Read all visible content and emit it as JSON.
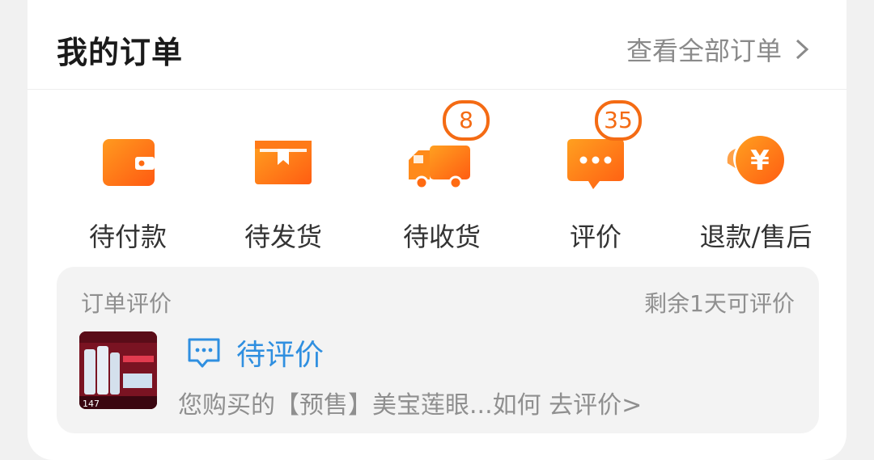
{
  "header": {
    "title": "我的订单",
    "view_all": "查看全部订单"
  },
  "order_status": [
    {
      "label": "待付款",
      "icon": "wallet-icon",
      "badge": null
    },
    {
      "label": "待发货",
      "icon": "package-box-icon",
      "badge": null
    },
    {
      "label": "待收货",
      "icon": "delivery-truck-icon",
      "badge": "8"
    },
    {
      "label": "评价",
      "icon": "chat-bubble-icon",
      "badge": "35"
    },
    {
      "label": "退款/售后",
      "icon": "refund-yen-icon",
      "badge": null
    }
  ],
  "review": {
    "title": "订单评价",
    "remaining": "剩余1天可评价",
    "status": "待评价",
    "description": "您购买的【预售】美宝莲眼...如何 去评价>",
    "thumb_price": "147"
  },
  "colors": {
    "accent_orange": "#f46b14",
    "link_blue": "#2f8fe0"
  }
}
